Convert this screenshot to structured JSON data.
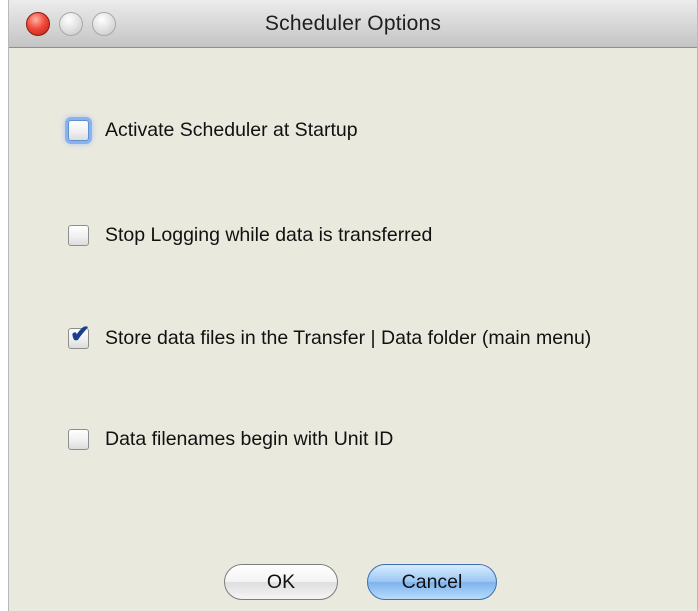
{
  "window": {
    "title": "Scheduler Options"
  },
  "options": [
    {
      "label": "Activate Scheduler at Startup",
      "checked": false,
      "focused": true
    },
    {
      "label": "Stop Logging while data is transferred",
      "checked": false,
      "focused": false
    },
    {
      "label": "Store data files in the Transfer | Data folder (main menu)",
      "checked": true,
      "focused": false
    },
    {
      "label": "Data filenames begin with Unit ID",
      "checked": false,
      "focused": false
    }
  ],
  "buttons": {
    "ok_label": "OK",
    "cancel_label": "Cancel"
  },
  "icons": {
    "close": "close-traffic-light-icon",
    "minimize": "minimize-traffic-light-icon",
    "zoom": "zoom-traffic-light-icon",
    "check": "checkmark-icon"
  },
  "colors": {
    "close_button": "#f04a3a",
    "content_background": "#eae9dd",
    "default_button": "#8fbff0",
    "checkmark": "#1b3f8b",
    "focus_ring": "#8cb2ea"
  }
}
